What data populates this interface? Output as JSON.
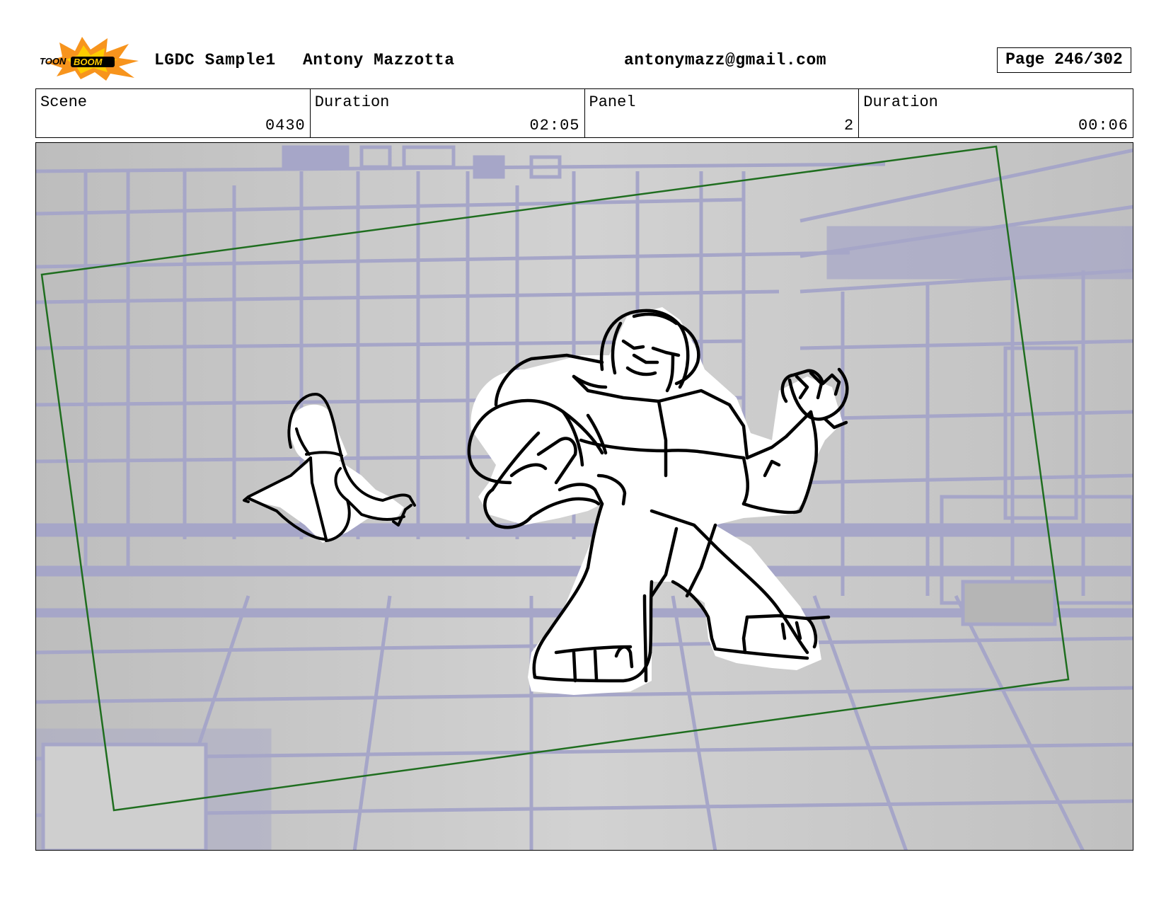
{
  "header": {
    "project": "LGDC Sample1",
    "author": "Antony Mazzotta",
    "email": "antonymazz@gmail.com",
    "page": "Page 246/302"
  },
  "logo": {
    "text_left": "TOON",
    "text_right": "BOOM",
    "colors": {
      "burst": "#f7941d",
      "core": "#ffcc00",
      "text": "#000000"
    }
  },
  "info": {
    "scene_label": "Scene",
    "scene_value": "0430",
    "scene_duration_label": "Duration",
    "scene_duration_value": "02:05",
    "panel_label": "Panel",
    "panel_value": "2",
    "panel_duration_label": "Duration",
    "panel_duration_value": "00:06"
  },
  "colors": {
    "background_gray": "#c4c4c4",
    "background_lines": "#a6a6c8",
    "camera_frame": "#1f6e1f",
    "sketch_line": "#000000"
  }
}
